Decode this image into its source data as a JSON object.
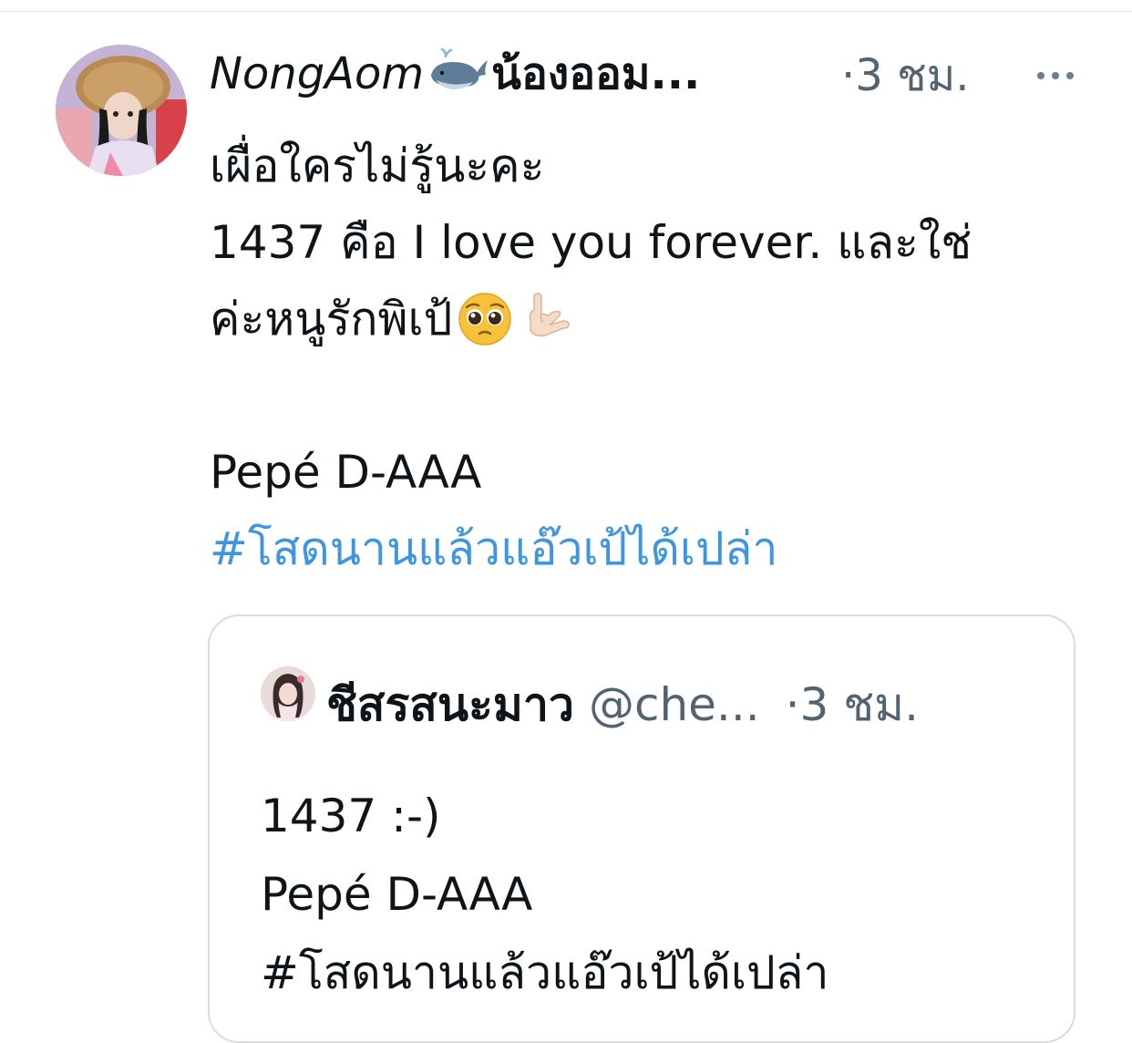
{
  "tweet": {
    "author": {
      "name_latin": "NongAom",
      "name_emoji_icon": "whale-icon",
      "name_thai": "น้องออม...",
      "avatar_icon": "profile-avatar-photo"
    },
    "timestamp": "·3 ชม.",
    "more_icon": "ellipsis-icon",
    "lines": [
      "เผื่อใครไม่รู้นะคะ",
      "1437 คือ I love you forever. และใช่",
      "ค่ะหนูรักพิเป้",
      "Pepé D-AAA"
    ],
    "line3_emojis": [
      "pleading-face-emoji",
      "sign-of-horns-emoji"
    ],
    "hashtag": "#โสดนานแล้วแอ๊วเป้ได้เปล่า",
    "link_color": "#3f96e0"
  },
  "quote": {
    "name": "ชีสรสนะมาว",
    "handle": "@che...",
    "timestamp": "·3 ชม.",
    "avatar_icon": "quote-avatar-photo",
    "lines": [
      "1437 :-)",
      "Pepé D-AAA",
      "#โสดนานแล้วแอ๊วเป้ได้เปล่า"
    ]
  }
}
